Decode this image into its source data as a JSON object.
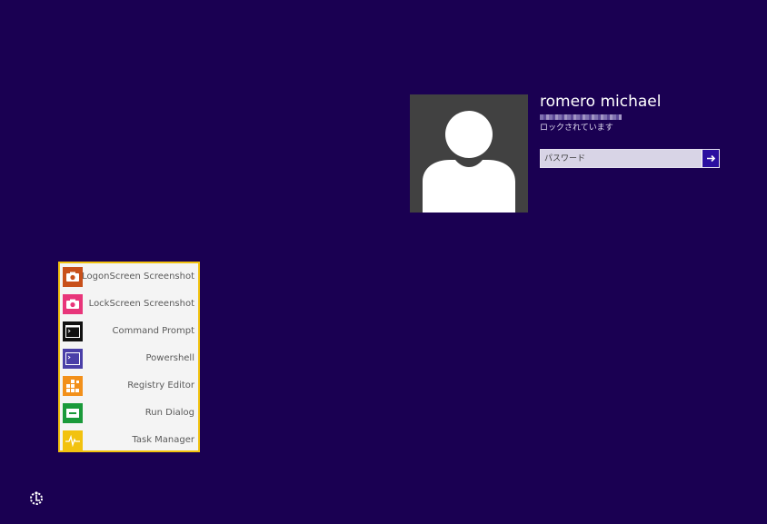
{
  "user": {
    "name": "romero michael",
    "status": "ロックされています"
  },
  "password": {
    "placeholder": "パスワード",
    "value": ""
  },
  "tools": [
    {
      "label": "LogonScreen Screenshot",
      "icon": "camera-icon",
      "color": "#c8501a"
    },
    {
      "label": "LockScreen Screenshot",
      "icon": "camera-icon",
      "color": "#e8357a"
    },
    {
      "label": "Command Prompt",
      "icon": "terminal-icon",
      "color": "#111111"
    },
    {
      "label": "Powershell",
      "icon": "powershell-icon",
      "color": "#4a3fa8"
    },
    {
      "label": "Registry Editor",
      "icon": "registry-icon",
      "color": "#f2901a"
    },
    {
      "label": "Run Dialog",
      "icon": "run-dialog-icon",
      "color": "#1a9a3a"
    },
    {
      "label": "Task Manager",
      "icon": "task-manager-icon",
      "color": "#f2c20f"
    }
  ],
  "colors": {
    "background": "#1a0052",
    "menu_border": "#f2c20f",
    "submit_button": "#2b0fa0"
  }
}
